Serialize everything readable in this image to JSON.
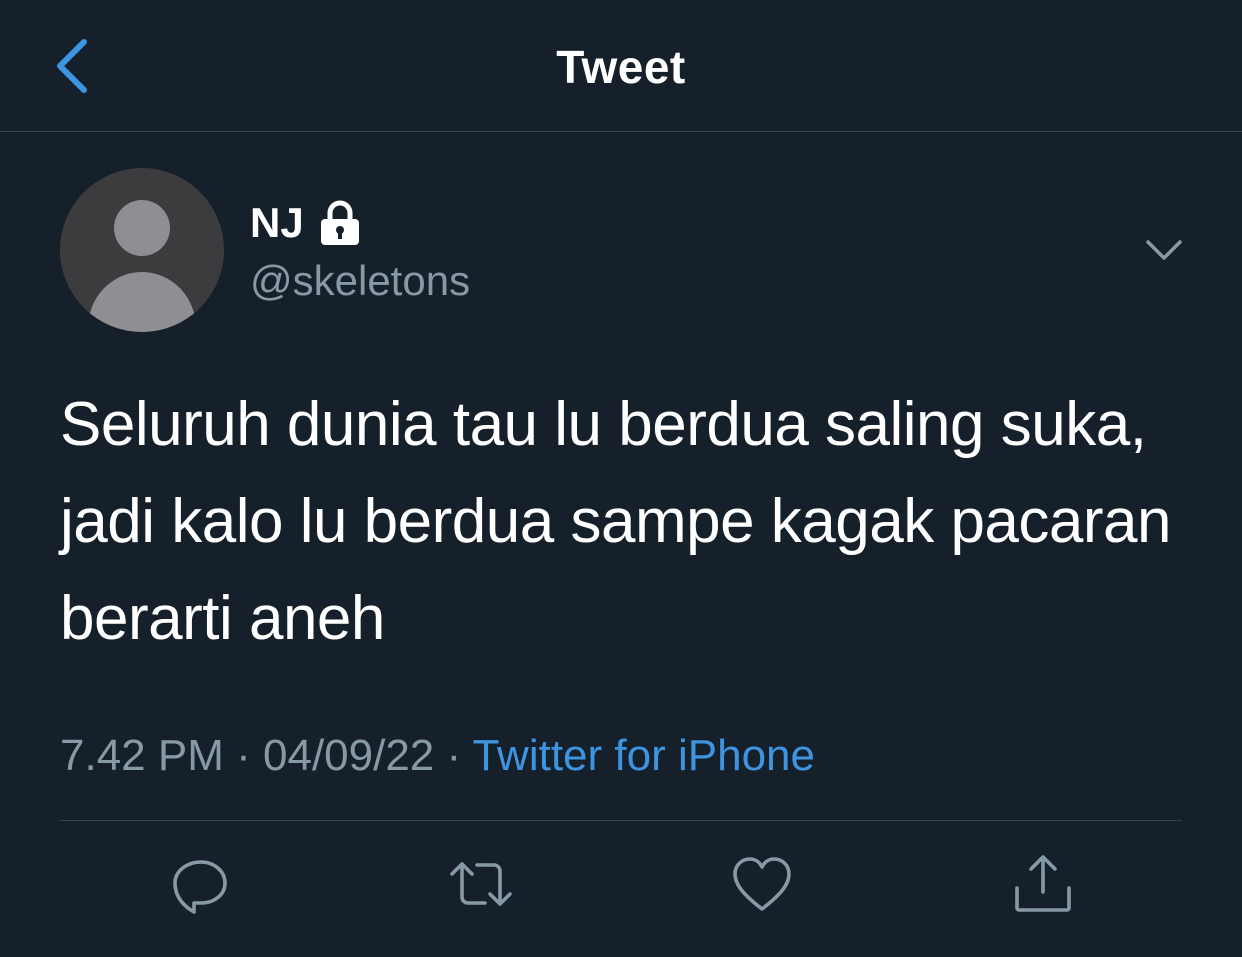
{
  "header": {
    "title": "Tweet",
    "back_icon": "chevron-left-icon"
  },
  "tweet": {
    "author": {
      "display_name": "NJ",
      "handle": "@skeletons",
      "protected_icon": "lock-icon",
      "avatar": "default-avatar"
    },
    "text": "Seluruh dunia tau lu berdua saling suka, jadi kalo lu berdua sampe kagak pacaran berarti aneh",
    "time": "7.42 PM",
    "separator": "·",
    "date": "04/09/22",
    "source": "Twitter for iPhone"
  },
  "actions": [
    {
      "name": "reply",
      "icon": "reply-icon"
    },
    {
      "name": "retweet",
      "icon": "retweet-icon"
    },
    {
      "name": "like",
      "icon": "heart-icon"
    },
    {
      "name": "share",
      "icon": "share-icon"
    }
  ],
  "colors": {
    "background": "#15202b",
    "accent": "#3d94e0",
    "secondary_text": "#8899a6",
    "divider": "#38444d"
  }
}
